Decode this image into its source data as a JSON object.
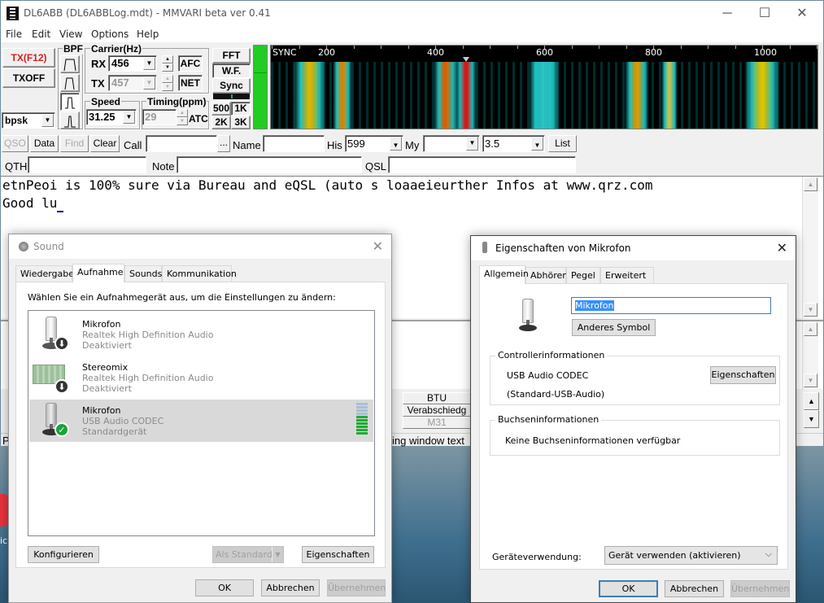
{
  "main_window": {
    "title": "DL6ABB (DL6ABBLog.mdt) - MMVARI beta ver 0.41",
    "controls": {
      "minimize": "─",
      "maximize": "☐",
      "close": "✕"
    },
    "menu": [
      "File",
      "Edit",
      "View",
      "Options",
      "Help"
    ]
  },
  "toolbar": {
    "tx_label": "TX(F12)",
    "txoff_label": "TXOFF",
    "mode_value": "bpsk",
    "bpf_label": "BPF",
    "carrier_label": "Carrier(Hz)",
    "rx_label": "RX",
    "rx_value": "456",
    "tx_label2": "TX",
    "tx_value": "457",
    "afc_label": "AFC",
    "net_label": "NET",
    "speed_label": "Speed",
    "speed_value": "31.25",
    "timing_label": "Timing(ppm)",
    "timing_value": "29",
    "atc_label": "ATC",
    "fft_label": "FFT",
    "wf_label": "W.F.",
    "sync_label": "Sync",
    "span_buttons": [
      "500",
      "1K",
      "2K",
      "3K"
    ]
  },
  "waterfall": {
    "sync_label": "SYNC",
    "freq_ticks": [
      "200",
      "400",
      "600",
      "800",
      "1000"
    ],
    "marker_freq": 456
  },
  "log_bar": {
    "qso_label": "QSO",
    "data_label": "Data",
    "find_label": "Find",
    "clear_label": "Clear",
    "call_label": "Call",
    "call_value": "",
    "ellipsis_label": "...",
    "name_label": "Name",
    "name_value": "",
    "his_label": "His",
    "his_value": "599",
    "my_label": "My",
    "my_value": "",
    "band_value": "3.5",
    "list_label": "List",
    "qth_label": "QTH",
    "note_label": "Note",
    "qsl_label": "QSL"
  },
  "rx_text": {
    "line1": "etnPeoi is 100% sure via Bureau and eQSL (auto  s loaaeieurther Infos at www.qrz.com",
    "line2": "Good lu"
  },
  "macro_grid": {
    "cells": [
      "BTU",
      "Verabschiedg",
      "M31"
    ],
    "status_text": "ing window text",
    "status_prefix": "P"
  },
  "sound_dialog": {
    "title": "Sound",
    "tabs": [
      "Wiedergabe",
      "Aufnahme",
      "Sounds",
      "Kommunikation"
    ],
    "active_tab": "Aufnahme",
    "instruction": "Wählen Sie ein Aufnahmegerät aus, um die Einstellungen zu ändern:",
    "devices": [
      {
        "name": "Mikrofon",
        "driver": "Realtek High Definition Audio",
        "status": "Deaktiviert",
        "icon": "microphone-icon",
        "badge": "disabled-arrow-icon"
      },
      {
        "name": "Stereomix",
        "driver": "Realtek High Definition Audio",
        "status": "Deaktiviert",
        "icon": "sound-card-icon",
        "badge": "disabled-arrow-icon"
      },
      {
        "name": "Mikrofon",
        "driver": "USB Audio CODEC",
        "status": "Standardgerät",
        "icon": "microphone-icon",
        "badge": "default-check-icon",
        "selected": true,
        "level_fraction": 0.6
      }
    ],
    "configure_label": "Konfigurieren",
    "set_default_label": "Als Standard",
    "properties_label": "Eigenschaften",
    "ok_label": "OK",
    "cancel_label": "Abbrechen",
    "apply_label": "Übernehmen"
  },
  "mic_props_dialog": {
    "title": "Eigenschaften von Mikrofon",
    "tabs": [
      "Allgemein",
      "Abhören",
      "Pegel",
      "Erweitert"
    ],
    "active_tab": "Allgemein",
    "name_value": "Mikrofon",
    "change_icon_label": "Anderes Symbol",
    "controller_legend": "Controllerinformationen",
    "controller_name": "USB Audio CODEC",
    "controller_driver": "(Standard-USB-Audio)",
    "controller_props_label": "Eigenschaften",
    "jack_legend": "Buchseninformationen",
    "jack_info": "Keine Buchseninformationen verfügbar",
    "usage_label": "Geräteverwendung:",
    "usage_value": "Gerät verwenden (aktivieren)",
    "ok_label": "OK",
    "cancel_label": "Abbrechen",
    "apply_label": "Übernehmen"
  },
  "colors": {
    "tx_red": "#d42020",
    "level_green": "#22cc22",
    "selection_blue": "#3390ff",
    "check_green": "#1aa33a"
  }
}
